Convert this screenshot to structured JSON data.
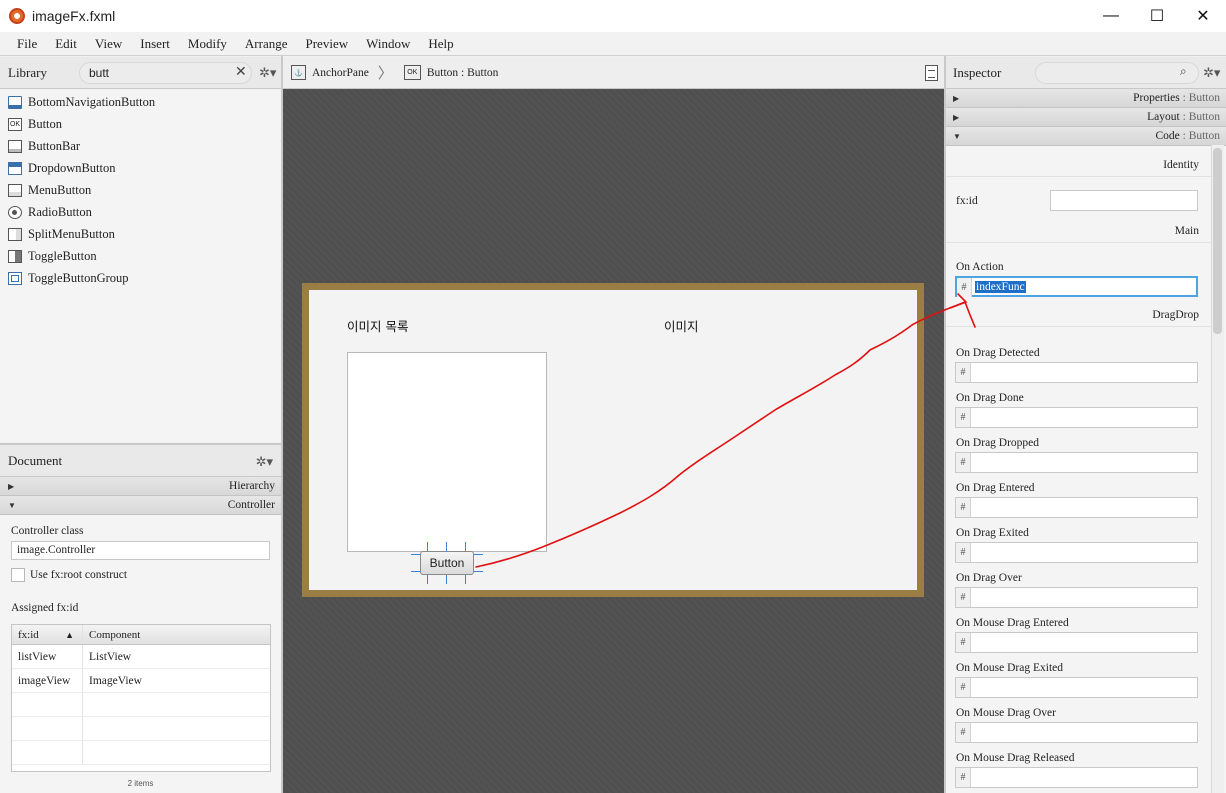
{
  "window": {
    "title": "imageFx.fxml",
    "minimize": "—",
    "maximize": "☐",
    "close": "✕"
  },
  "menu": [
    "File",
    "Edit",
    "View",
    "Insert",
    "Modify",
    "Arrange",
    "Preview",
    "Window",
    "Help"
  ],
  "library": {
    "title": "Library",
    "search_value": "butt",
    "clear": "✕",
    "gear": "✲▾",
    "items": [
      "BottomNavigationButton",
      "Button",
      "ButtonBar",
      "DropdownButton",
      "MenuButton",
      "RadioButton",
      "SplitMenuButton",
      "ToggleButton",
      "ToggleButtonGroup"
    ],
    "item_icons": [
      "bottom-nav-icon",
      "ok-button-icon",
      "button-bar-icon",
      "dropdown-icon",
      "menu-button-icon",
      "radio-icon",
      "split-menu-icon",
      "toggle-icon",
      "toggle-group-icon"
    ]
  },
  "document": {
    "title": "Document",
    "gear": "✲▾",
    "hierarchy": "Hierarchy",
    "controller": "Controller",
    "controller_class_label": "Controller class",
    "controller_class_value": "image.Controller",
    "fxroot_label": "Use fx:root construct",
    "assigned_label": "Assigned fx:id",
    "table": {
      "headers": [
        "fx:id",
        "Component"
      ],
      "sort_indicator": "▲",
      "rows": [
        [
          "listView",
          "ListView"
        ],
        [
          "imageView",
          "ImageView"
        ]
      ]
    },
    "item_count": "2 items"
  },
  "breadcrumb": {
    "items": [
      "AnchorPane",
      "Button : Button"
    ],
    "icons": [
      "anchor-icon",
      "ok-button-icon"
    ],
    "icon_text": [
      "⚓",
      "OK"
    ],
    "separator": "〉"
  },
  "canvas": {
    "list_label": "이미지 목록",
    "image_label": "이미지",
    "button_text": "Button",
    "frame_color": "#9b7e44",
    "annotation_color": "#e01010"
  },
  "inspector": {
    "title": "Inspector",
    "search_icon": "⌕",
    "gear": "✲▾",
    "sections": [
      {
        "name": "Properties",
        "target": "Button"
      },
      {
        "name": "Layout",
        "target": "Button"
      },
      {
        "name": "Code",
        "target": "Button"
      }
    ],
    "identity_title": "Identity",
    "fxid_label": "fx:id",
    "main_title": "Main",
    "on_action_label": "On Action",
    "on_action_value": "indexFunc",
    "dragdrop_title": "DragDrop",
    "hash": "#",
    "event_fields": [
      "On Drag Detected",
      "On Drag Done",
      "On Drag Dropped",
      "On Drag Entered",
      "On Drag Exited",
      "On Drag Over",
      "On Mouse Drag Entered",
      "On Mouse Drag Exited",
      "On Mouse Drag Over",
      "On Mouse Drag Released"
    ]
  }
}
